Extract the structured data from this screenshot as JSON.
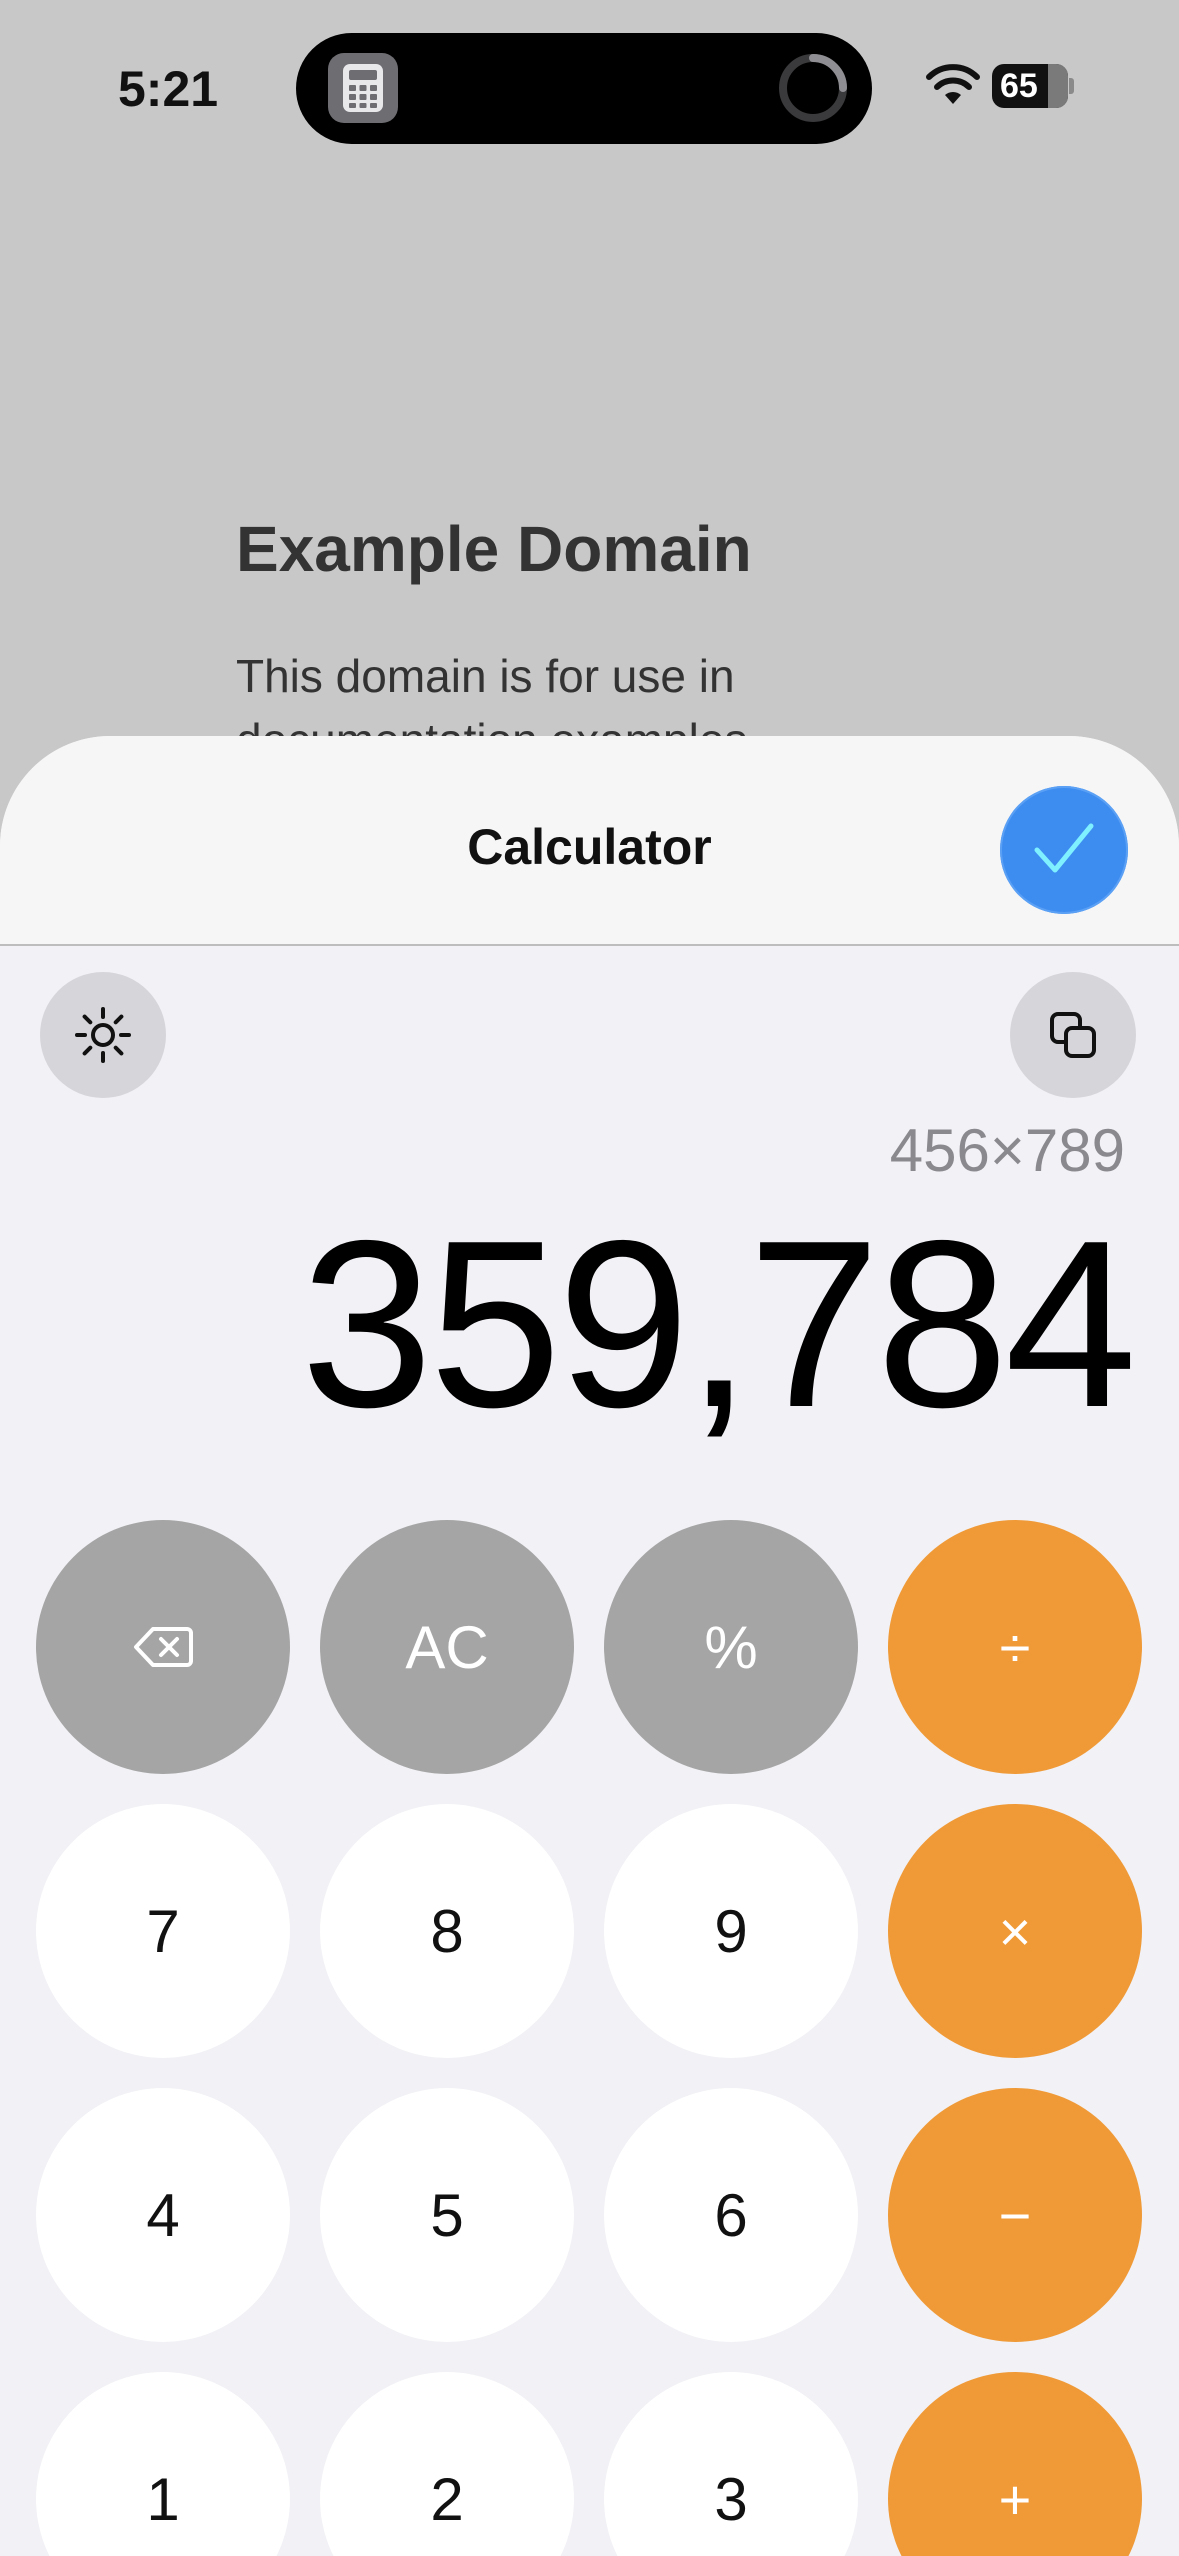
{
  "status_bar": {
    "time": "5:21",
    "battery": "65",
    "icons": [
      "calculator-icon",
      "loading-ring-icon",
      "wifi-icon",
      "battery-icon"
    ]
  },
  "background_page": {
    "title": "Example Domain",
    "body": "This domain is for use in documentation examples"
  },
  "sheet": {
    "title": "Calculator",
    "done_icon": "checkmark-icon",
    "theme_icon": "sun-icon",
    "copy_icon": "copy-icon"
  },
  "display": {
    "expression": "456×789",
    "result": "359,784"
  },
  "keypad": {
    "row1": [
      "⌫",
      "AC",
      "%",
      "÷"
    ],
    "row2": [
      "7",
      "8",
      "9",
      "×"
    ],
    "row3": [
      "4",
      "5",
      "6",
      "−"
    ],
    "row4": [
      "1",
      "2",
      "3",
      "+"
    ]
  },
  "colors": {
    "function_key": "#a5a5a5",
    "number_key": "#ffffff",
    "operator_key": "#f09a37",
    "done_button": "#3d8cf0"
  }
}
